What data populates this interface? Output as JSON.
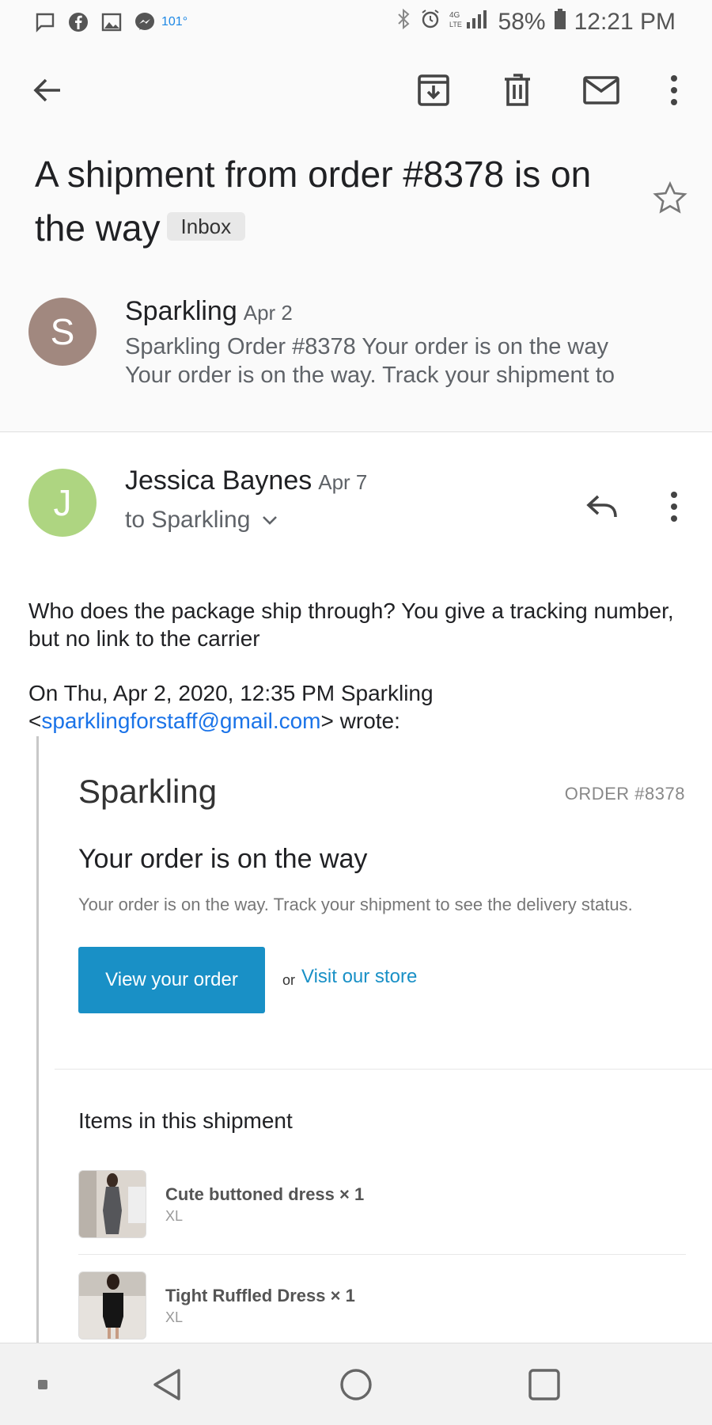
{
  "status_bar": {
    "temperature": "101°",
    "network": "4G LTE",
    "battery": "58%",
    "time": "12:21 PM"
  },
  "toolbar": {
    "back_icon": "arrow-left-icon",
    "archive_icon": "archive-icon",
    "delete_icon": "trash-icon",
    "mark_unread_icon": "mail-icon",
    "more_icon": "more-vert-icon"
  },
  "subject": {
    "text": "A shipment from order #8378 is on the way",
    "label": "Inbox"
  },
  "messages": [
    {
      "avatar_letter": "S",
      "avatar_color": "#a1887f",
      "sender": "Sparkling",
      "date": "Apr 2",
      "snippet_line1": "Sparkling Order #8378 Your order is on the way",
      "snippet_line2": "Your order is on the way. Track your shipment to"
    },
    {
      "avatar_letter": "J",
      "avatar_color": "#aed581",
      "sender": "Jessica Baynes",
      "date": "Apr 7",
      "to": "to Sparkling",
      "body": "Who does the package ship through? You give a tracking number, but no link to the carrier",
      "quote_header_line1": "On Thu, Apr 2, 2020, 12:35 PM Sparkling",
      "quote_email": "sparklingforstaff@gmail.com",
      "quote_header_suffix": "wrote:"
    }
  ],
  "quoted_email": {
    "shop_name": "Sparkling",
    "order_number": "ORDER #8378",
    "title": "Your order is on the way",
    "description": "Your order is on the way. Track your shipment to see the delivery status.",
    "view_order_button": "View your order",
    "or_text": "or",
    "store_link": "Visit our store",
    "items_title": "Items in this shipment",
    "items": [
      {
        "name": "Cute buttoned dress × 1",
        "variant": "XL"
      },
      {
        "name": "Tight Ruffled Dress × 1",
        "variant": "XL"
      }
    ]
  },
  "colors": {
    "accent_blue": "#1a73e8",
    "button_blue": "#1990c6"
  }
}
